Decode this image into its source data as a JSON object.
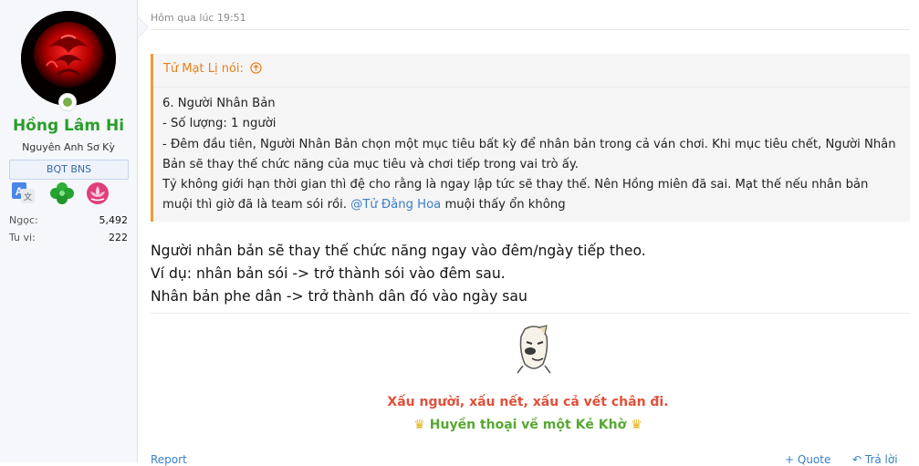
{
  "user": {
    "name": "Hồng Lâm Hi",
    "title": "Nguyên Anh Sơ Kỳ",
    "banner": "BQT BNS",
    "badges": [
      "translate-icon",
      "clover-icon",
      "lotus-icon"
    ],
    "stats": [
      {
        "label": "Ngọc:",
        "value": "5,492"
      },
      {
        "label": "Tu vi:",
        "value": "222"
      }
    ]
  },
  "post": {
    "timestamp": "Hôm qua lúc 19:51",
    "quote": {
      "author_line": "Tử Mạt Lị nói:",
      "lines": [
        "6. Người Nhân Bản",
        "- Số lượng: 1 người",
        "- Đêm đầu tiên, Người Nhân Bản chọn một mục tiêu bất kỳ để nhân bản trong cả ván chơi. Khi mục tiêu chết, Người Nhân Bản sẽ thay thế chức năng của mục tiêu và chơi tiếp trong vai trò ấy.",
        "Tỷ không giới hạn thời gian thì đệ cho rằng là ngay lập tức sẽ thay thế. Nên Hồng miên đã sai. Mạt thế nếu nhân bản muội thì giờ đã là team sói rồi.",
        "@Tử Đằng Hoa",
        "muội thấy ổn không"
      ]
    },
    "message": [
      "Người nhân bản sẽ thay thế chức năng ngay vào đêm/ngày tiếp theo.",
      "Ví dụ: nhân bản sói -> trở thành sói vào đêm sau.",
      "Nhân bản phe dân -> trở thành dân đó vào ngày sau"
    ],
    "signature": {
      "line1": "Xấu người, xấu nết, xấu cả vết chân đi.",
      "line2": "Huyền thoại về một Kẻ Khờ",
      "crown": "♛"
    },
    "footer": {
      "report": "Report",
      "quote": "+ Quote",
      "reply": "Trả lời"
    }
  },
  "colors": {
    "username": "#2b9d2b",
    "quote_accent": "#f39c2f",
    "link": "#3a7fc8",
    "sig1": "#e0503a",
    "sig2": "#56a832"
  }
}
